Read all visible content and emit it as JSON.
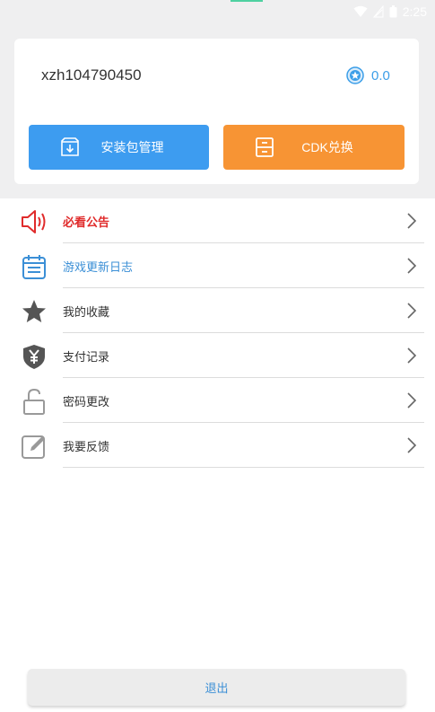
{
  "status_bar": {
    "time": "2:25"
  },
  "account": {
    "username": "xzh104790450",
    "coin_balance": "0.0"
  },
  "actions": {
    "install_label": "安装包管理",
    "cdk_label": "CDK兑换"
  },
  "menu": {
    "items": [
      {
        "label": "必看公告",
        "icon": "speaker-icon",
        "color": "#e02b2b"
      },
      {
        "label": "游戏更新日志",
        "icon": "calendar-icon",
        "color": "#3b8fd6"
      },
      {
        "label": "我的收藏",
        "icon": "star-icon",
        "color": "#333333"
      },
      {
        "label": "支付记录",
        "icon": "yen-shield-icon",
        "color": "#333333"
      },
      {
        "label": "密码更改",
        "icon": "unlock-icon",
        "color": "#333333"
      },
      {
        "label": "我要反馈",
        "icon": "edit-icon",
        "color": "#333333"
      }
    ]
  },
  "logout_label": "退出",
  "colors": {
    "accent_blue": "#3d9cf0",
    "accent_orange": "#f79434",
    "alert_red": "#e02b2b"
  }
}
